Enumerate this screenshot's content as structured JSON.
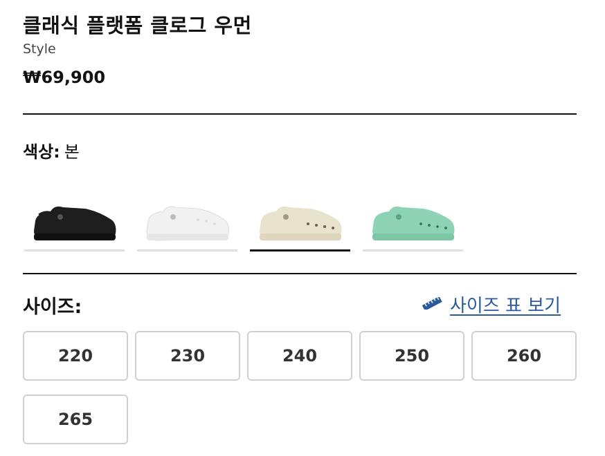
{
  "product": {
    "title": "클래식 플랫폼 클로그 우먼",
    "style_label": "Style",
    "price": "₩69,900"
  },
  "color": {
    "label": "색상:",
    "selected": "본",
    "swatches": [
      {
        "name": "black",
        "hex": "#1e1e1e",
        "selected": false
      },
      {
        "name": "white",
        "hex": "#f3f3f3",
        "selected": false
      },
      {
        "name": "bone",
        "hex": "#e8e3cc",
        "selected": true
      },
      {
        "name": "jade",
        "hex": "#8fd3b6",
        "selected": false
      }
    ]
  },
  "size": {
    "label": "사이즈:",
    "chart_link": "사이즈 표 보기",
    "options": [
      "220",
      "230",
      "240",
      "250",
      "260",
      "265"
    ]
  },
  "colors": {
    "link": "#2a5a9c",
    "selected_bar": "#111111",
    "unselected_bar": "#e0e0e0"
  }
}
